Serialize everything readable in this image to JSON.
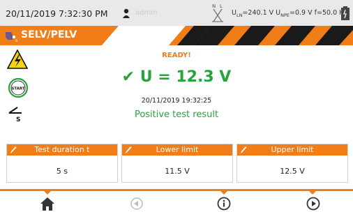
{
  "status": {
    "datetime": "20/11/2019 7:32:30 PM",
    "user": "admin",
    "measurements": {
      "uln_label": "U",
      "uln_sub": "LN",
      "uln_value": "=240.1 V",
      "unpe_label": "U",
      "unpe_sub": "NPE",
      "unpe_value": "=0.9 V",
      "freq": "f=50.0 Hz"
    },
    "nl_symbol": "N L"
  },
  "header": {
    "title": "SELV/PELV"
  },
  "main": {
    "ready": "READY!",
    "voltage": "✔ U = 12.3 V",
    "timestamp": "20/11/2019 19:32:25",
    "result": "Positive test result"
  },
  "params": [
    {
      "title": "Test duration t",
      "value": "5 s"
    },
    {
      "title": "Lower limit",
      "value": "11.5 V"
    },
    {
      "title": "Upper limit",
      "value": "12.5 V"
    }
  ],
  "start_label": "START",
  "colors": {
    "accent": "#f07d17",
    "ok": "#26a33a",
    "statusbar": "#e9e9e9"
  },
  "nav": {
    "items": [
      "home-icon",
      "back-icon",
      "info-icon",
      "next-icon"
    ]
  }
}
